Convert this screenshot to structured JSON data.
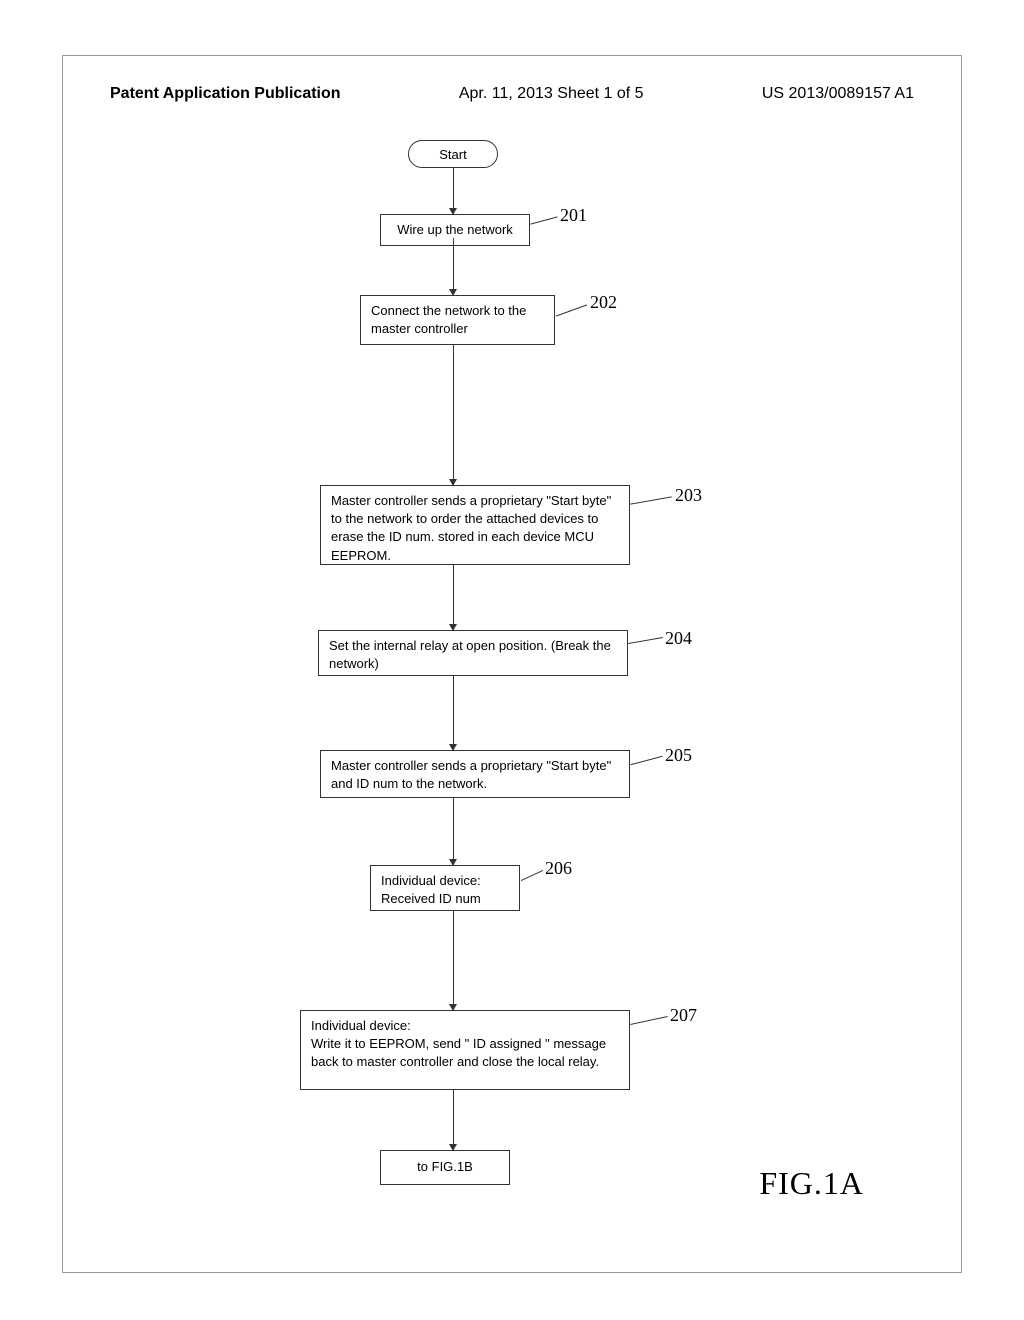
{
  "header": {
    "left": "Patent Application Publication",
    "center": "Apr. 11, 2013  Sheet 1 of 5",
    "right": "US 2013/0089157 A1"
  },
  "labels": {
    "l201": "201",
    "l202": "202",
    "l203": "203",
    "l204": "204",
    "l205": "205",
    "l206": "206",
    "l207": "207"
  },
  "flowchart": {
    "start": "Start",
    "step201": "Wire up the network",
    "step202": "Connect the network to the master controller",
    "step203": "Master controller sends a proprietary \"Start byte\" to the network to order the attached devices to erase the ID num. stored in each device MCU EEPROM.",
    "step204": "Set the internal relay at open position. (Break the network)",
    "step205": "Master controller sends a proprietary \"Start byte\" and ID num to the network.",
    "step206": "Individual device: Received ID num",
    "step207": "Individual device:\nWrite it to EEPROM, send \" ID assigned \" message back to master controller and close the local relay.",
    "continue": "to FIG.1B"
  },
  "figure_label": "FIG.1A"
}
